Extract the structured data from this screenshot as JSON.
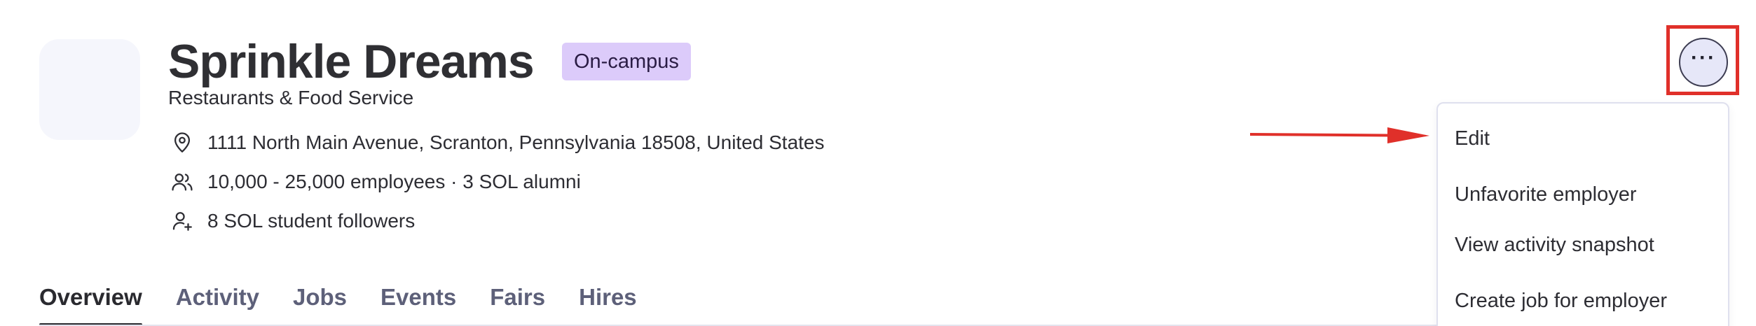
{
  "employer": {
    "name": "Sprinkle Dreams",
    "badge": "On-campus",
    "industry": "Restaurants & Food Service",
    "address": "1111 North Main Avenue, Scranton, Pennsylvania 18508, United States",
    "employees": "10,000 - 25,000 employees · 3 SOL alumni",
    "followers": "8 SOL student followers"
  },
  "icons": {
    "address": "location-pin-icon",
    "employees": "users-icon",
    "followers": "user-plus-icon",
    "more": "ellipsis-icon"
  },
  "tabs": [
    {
      "label": "Overview",
      "active": true
    },
    {
      "label": "Activity",
      "active": false
    },
    {
      "label": "Jobs",
      "active": false
    },
    {
      "label": "Events",
      "active": false
    },
    {
      "label": "Fairs",
      "active": false
    },
    {
      "label": "Hires",
      "active": false
    }
  ],
  "menu": {
    "more_label": "···",
    "items": [
      {
        "label": "Edit"
      },
      {
        "label": "Unfavorite employer"
      },
      {
        "label": "View activity snapshot"
      },
      {
        "label": "Create job for employer"
      }
    ]
  },
  "colors": {
    "badge_bg": "#dccbfa",
    "highlight": "#e0302a",
    "tab_inactive": "#5d6079",
    "tab_active": "#2a2a2f"
  }
}
